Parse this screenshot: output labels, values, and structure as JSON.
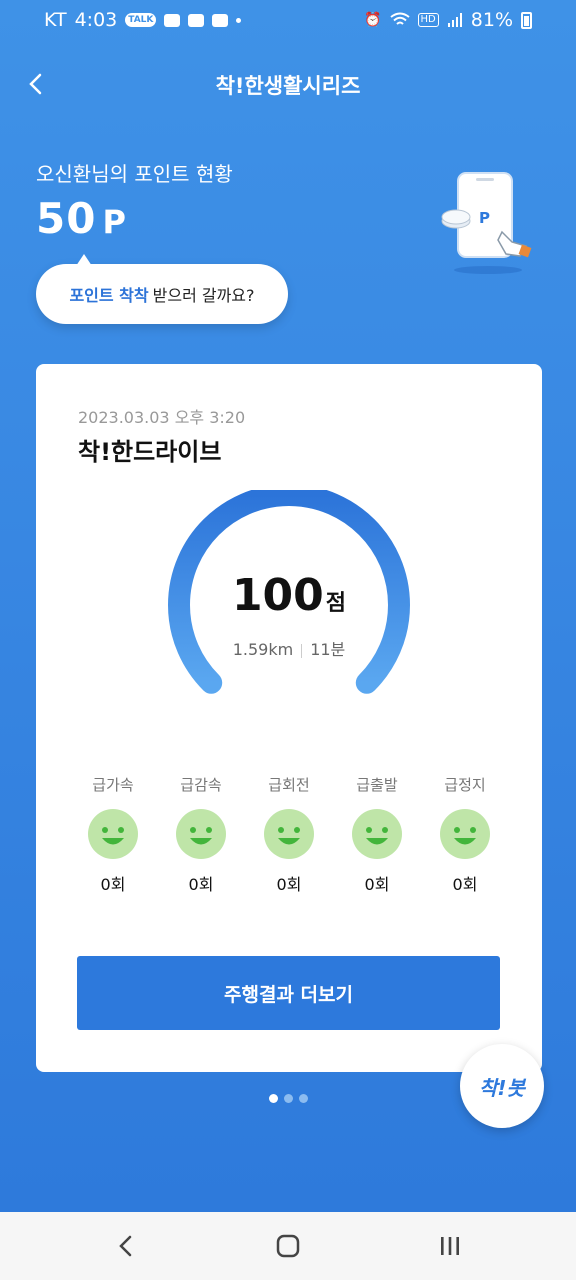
{
  "status": {
    "carrier": "KT",
    "time": "4:03",
    "talk": "TALK",
    "hd": "HD",
    "battery": "81%"
  },
  "header": {
    "title": "착!한생활시리즈",
    "back_icon": "chevron-left-icon"
  },
  "points": {
    "label": "오신환님의 포인트 현황",
    "value": "50",
    "unit": "P",
    "bubble_highlight": "포인트 착착",
    "bubble_rest": "받으러 갈까요?",
    "illustration_letter": "P"
  },
  "card": {
    "date": "2023.03.03 오후 3:20",
    "title": "착!한드라이브",
    "score": "100",
    "score_unit": "점",
    "distance": "1.59km",
    "duration": "11분",
    "gauge_level": 1.0,
    "metrics": [
      {
        "label": "급가속",
        "count": "0회"
      },
      {
        "label": "급감속",
        "count": "0회"
      },
      {
        "label": "급회전",
        "count": "0회"
      },
      {
        "label": "급출발",
        "count": "0회"
      },
      {
        "label": "급정지",
        "count": "0회"
      }
    ],
    "more_button": "주행결과 더보기"
  },
  "pager": {
    "count": 3,
    "active": 0
  },
  "fab": {
    "label": "착!봇"
  },
  "navbar": {
    "icons": [
      "back-icon",
      "home-icon",
      "recents-icon"
    ]
  },
  "colors": {
    "accent": "#2d79dc",
    "background": "#3887e2",
    "smile_face": "#bfe5a8",
    "smile_features": "#43b53b"
  }
}
